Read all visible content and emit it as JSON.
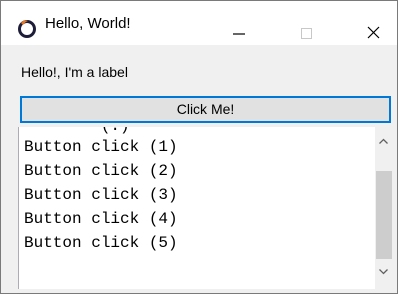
{
  "window": {
    "title": "Hello, World!",
    "app_icon": "app-logo-icon",
    "controls": {
      "minimize_icon": "minimize-icon",
      "maximize_icon": "maximize-icon",
      "close_icon": "close-icon"
    }
  },
  "content": {
    "label": "Hello!, I'm a label",
    "button_label": "Click Me!",
    "output_lines": [
      "Button click (1)",
      "Button click (2)",
      "Button click (3)",
      "Button click (4)",
      "Button click (5)"
    ],
    "partial_line": "        (.)"
  },
  "colors": {
    "button_border": "#0078d7",
    "button_bg": "#e1e1e1",
    "window_bg": "#f0f0f0"
  }
}
